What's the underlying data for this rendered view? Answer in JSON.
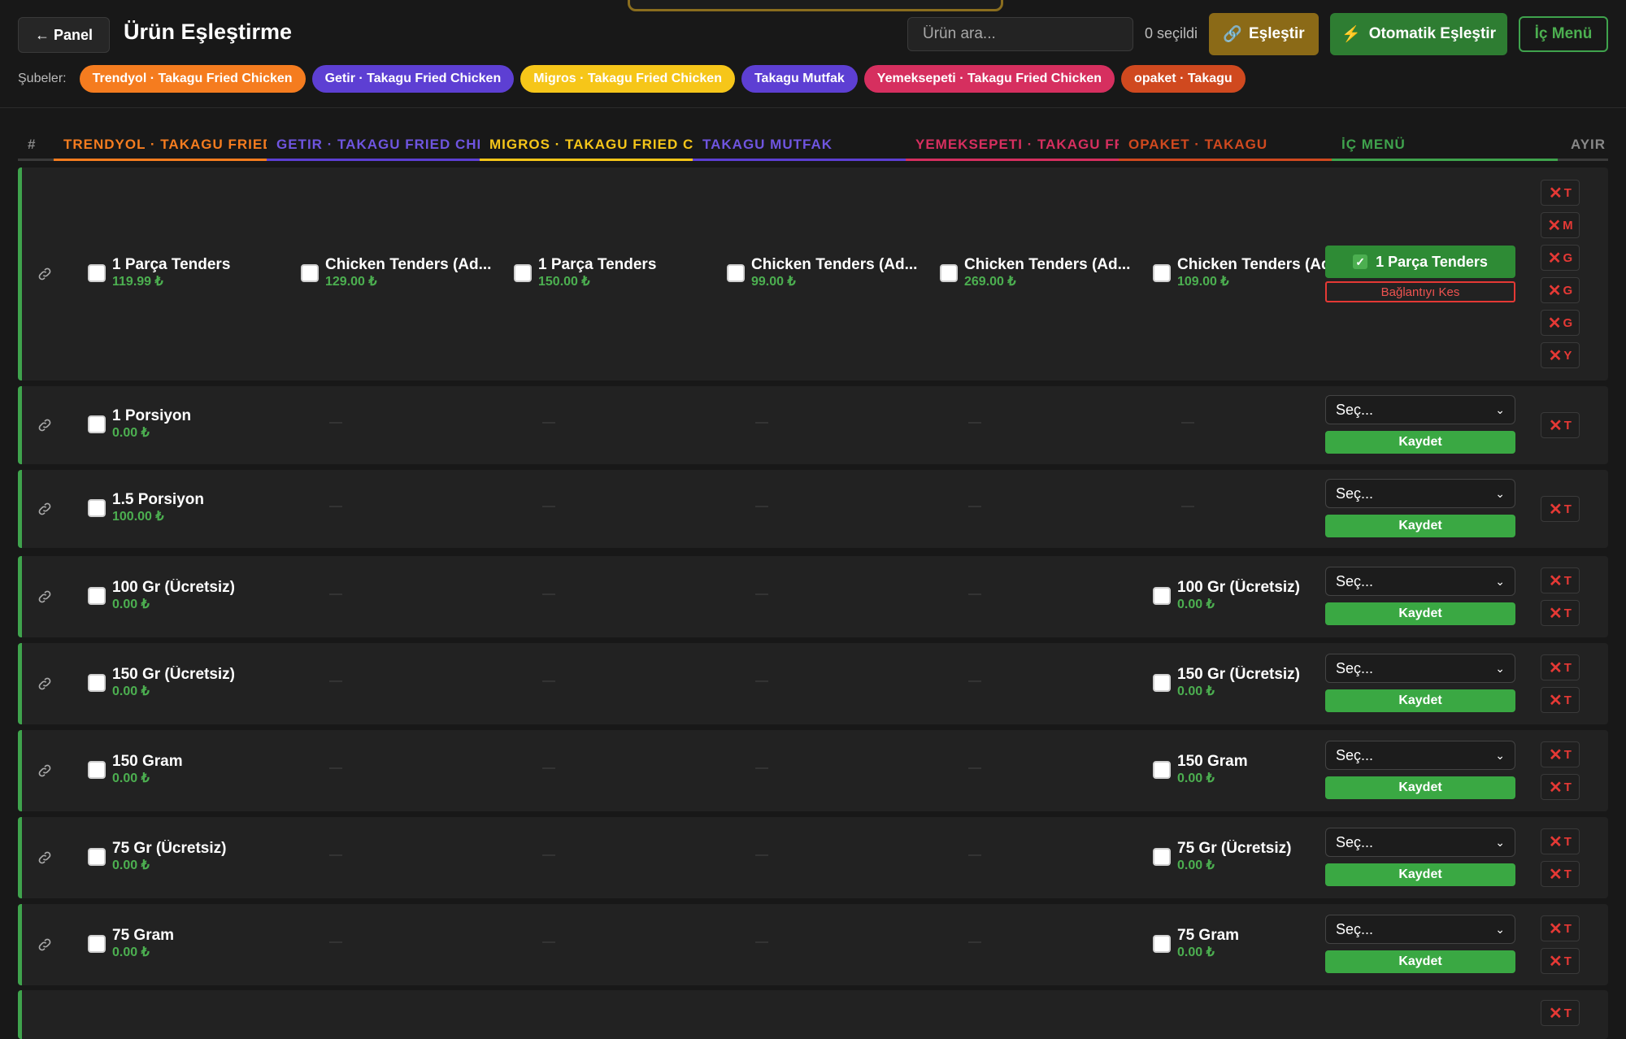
{
  "header": {
    "back_label": "← Panel",
    "title": "Ürün Eşleştirme",
    "search_placeholder": "Ürün ara...",
    "selected_count": "0 seçildi",
    "match_label": "Eşleştir",
    "auto_match_label": "Otomatik Eşleştir",
    "internal_menu_label": "İç Menü"
  },
  "branches": {
    "label": "Şubeler:",
    "items": [
      {
        "label": "Trendyol · Takagu Fried Chicken",
        "color": "#f57c1f",
        "text": "#ffffff"
      },
      {
        "label": "Getir · Takagu Fried Chicken",
        "color": "#5d3fd3",
        "text": "#ffffff"
      },
      {
        "label": "Migros · Takagu Fried Chicken",
        "color": "#f6c619",
        "text": "#ffffff"
      },
      {
        "label": "Takagu Mutfak",
        "color": "#5d3fd3",
        "text": "#ffffff"
      },
      {
        "label": "Yemeksepeti · Takagu Fried Chicken",
        "color": "#d62f5f",
        "text": "#ffffff"
      },
      {
        "label": "opaket · Takagu",
        "color": "#d0491f",
        "text": "#ffffff"
      }
    ]
  },
  "columns": {
    "hash": "#",
    "trendyol": "Trendyol · Takagu Fried Chicken",
    "getir": "Getir · Takagu Fried Chicken",
    "migros": "Migros · Takagu Fried Chicken",
    "mutfak": "Takagu Mutfak",
    "yemeksepeti": "Yemeksepeti · Takagu Fried Chicken",
    "opaket": "opaket · Takagu",
    "ic_menu": "İç Menü",
    "ayir": "Ayır"
  },
  "column_colors": {
    "hash": "#888888",
    "trendyol": "#f57c1f",
    "getir": "#5d3fd3",
    "migros": "#f6c619",
    "mutfak": "#5d3fd3",
    "yemeksepeti": "#d62f5f",
    "opaket": "#d0491f",
    "ic_menu": "#3fa34d",
    "ayir": "#888888"
  },
  "rows": [
    {
      "cells": [
        {
          "name": "1 Parça Tenders",
          "price": "119.99 ₺"
        },
        {
          "name": "Chicken Tenders (Ad...",
          "price": "129.00 ₺"
        },
        {
          "name": "1 Parça Tenders",
          "price": "150.00 ₺"
        },
        {
          "name": "Chicken Tenders (Ad...",
          "price": "99.00 ₺"
        },
        {
          "name": "Chicken Tenders (Ad...",
          "price": "269.00 ₺"
        },
        {
          "name": "Chicken Tenders (Ad...",
          "price": "109.00 ₺"
        }
      ],
      "matched": "1 Parça Tenders",
      "unlink": "Bağlantıyı Kes",
      "split": [
        "T",
        "M",
        "G",
        "G",
        "G",
        "Y"
      ]
    },
    {
      "cells": [
        {
          "name": "1 Porsiyon",
          "price": "0.00 ₺"
        },
        null,
        null,
        null,
        null,
        null
      ],
      "select": "Seç...",
      "save": "Kaydet",
      "split": [
        "T"
      ]
    },
    {
      "cells": [
        {
          "name": "1.5 Porsiyon",
          "price": "100.00 ₺"
        },
        null,
        null,
        null,
        null,
        null
      ],
      "select": "Seç...",
      "save": "Kaydet",
      "split": [
        "T"
      ]
    },
    {
      "cells": [
        {
          "name": "100 Gr (Ücretsiz)",
          "price": "0.00 ₺"
        },
        null,
        null,
        null,
        null,
        {
          "name": "100 Gr (Ücretsiz)",
          "price": "0.00 ₺"
        }
      ],
      "select": "Seç...",
      "save": "Kaydet",
      "split": [
        "T",
        "T"
      ]
    },
    {
      "cells": [
        {
          "name": "150 Gr (Ücretsiz)",
          "price": "0.00 ₺"
        },
        null,
        null,
        null,
        null,
        {
          "name": "150 Gr (Ücretsiz)",
          "price": "0.00 ₺"
        }
      ],
      "select": "Seç...",
      "save": "Kaydet",
      "split": [
        "T",
        "T"
      ]
    },
    {
      "cells": [
        {
          "name": "150 Gram",
          "price": "0.00 ₺"
        },
        null,
        null,
        null,
        null,
        {
          "name": "150 Gram",
          "price": "0.00 ₺"
        }
      ],
      "select": "Seç...",
      "save": "Kaydet",
      "split": [
        "T",
        "T"
      ]
    },
    {
      "cells": [
        {
          "name": "75 Gr (Ücretsiz)",
          "price": "0.00 ₺"
        },
        null,
        null,
        null,
        null,
        {
          "name": "75 Gr (Ücretsiz)",
          "price": "0.00 ₺"
        }
      ],
      "select": "Seç...",
      "save": "Kaydet",
      "split": [
        "T",
        "T"
      ]
    },
    {
      "cells": [
        {
          "name": "75 Gram",
          "price": "0.00 ₺"
        },
        null,
        null,
        null,
        null,
        {
          "name": "75 Gram",
          "price": "0.00 ₺"
        }
      ],
      "select": "Seç...",
      "save": "Kaydet",
      "split": [
        "T",
        "T"
      ]
    },
    {
      "cells": [
        null,
        null,
        null,
        null,
        null,
        null
      ],
      "split": [
        "T"
      ]
    }
  ]
}
